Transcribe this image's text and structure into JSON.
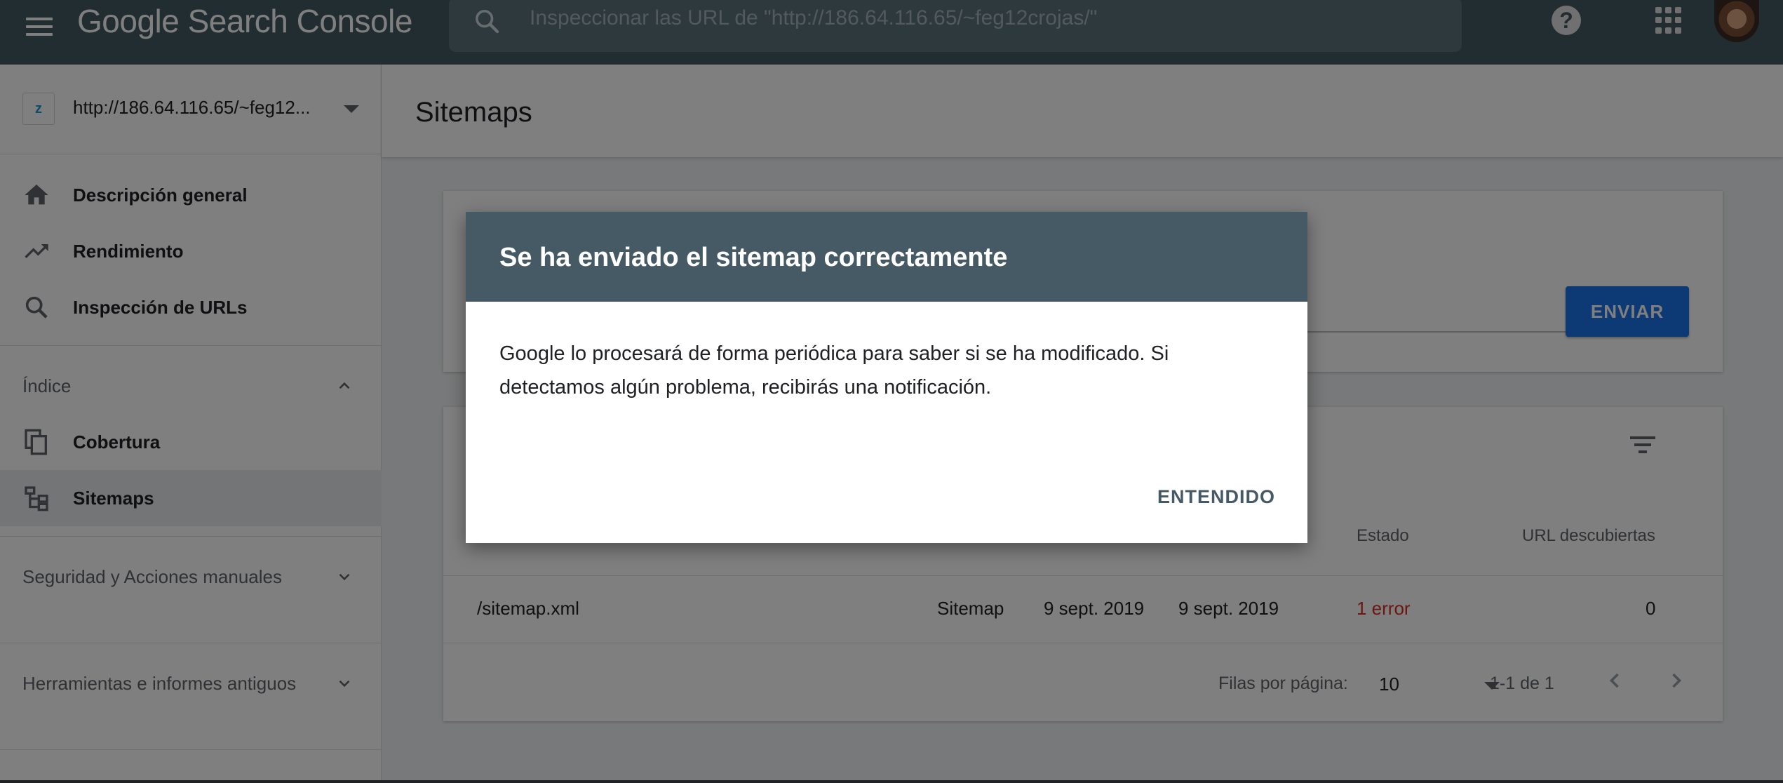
{
  "topbar": {
    "logo_text": "Google Search Console",
    "search_placeholder": "Inspeccionar las URL de \"http://186.64.116.65/~feg12crojas/\"",
    "help_icon": "help-circle-icon",
    "apps_icon": "apps-grid-icon"
  },
  "sidebar": {
    "property_url": "http://186.64.116.65/~feg12...",
    "items_top": [
      {
        "label": "Descripción general",
        "icon": "home-icon"
      },
      {
        "label": "Rendimiento",
        "icon": "trending-up-icon"
      },
      {
        "label": "Inspección de URLs",
        "icon": "search-icon"
      }
    ],
    "section_index": "Índice",
    "items_index": [
      {
        "label": "Cobertura",
        "icon": "copy-icon"
      },
      {
        "label": "Sitemaps",
        "icon": "sitemap-icon"
      }
    ],
    "section_security": "Seguridad y Acciones manuales",
    "section_tools": "Herramientas e informes antiguos"
  },
  "main": {
    "page_title": "Sitemaps",
    "submit_button": "ENVIAR",
    "table": {
      "headers": [
        "Estado",
        "URL descubiertas"
      ],
      "row": {
        "sitemap": "/sitemap.xml",
        "type": "Sitemap",
        "submitted": "9 sept. 2019",
        "last_read": "9 sept. 2019",
        "status": "1 error",
        "discovered": "0"
      },
      "rows_per_page_label": "Filas por página:",
      "rows_per_page_value": "10",
      "range": "1-1 de 1"
    }
  },
  "dialog": {
    "title": "Se ha enviado el sitemap correctamente",
    "body": "Google lo procesará de forma periódica para saber si se ha modificado. Si detectamos algún problema, recibirás una notificación.",
    "confirm_button": "ENTENDIDO"
  },
  "colors": {
    "header": "#455a64",
    "primary_button": "#1a73e8",
    "error": "#d93025"
  }
}
